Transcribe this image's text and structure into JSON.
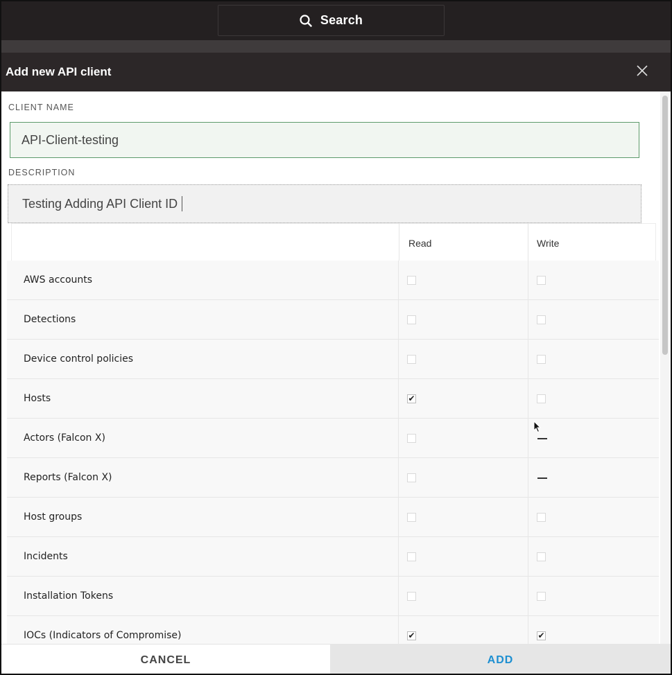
{
  "topbar": {
    "search_label": "Search"
  },
  "modal": {
    "title": "Add new API client"
  },
  "form": {
    "client_name_label": "CLIENT NAME",
    "client_name_value": "API-Client-testing",
    "description_label": "DESCRIPTION",
    "description_value": "Testing Adding API Client ID"
  },
  "permissions": {
    "read_header": "Read",
    "write_header": "Write",
    "rows": [
      {
        "name": "AWS accounts",
        "read": "unchecked",
        "write": "unchecked"
      },
      {
        "name": "Detections",
        "read": "unchecked",
        "write": "unchecked"
      },
      {
        "name": "Device control policies",
        "read": "unchecked",
        "write": "unchecked"
      },
      {
        "name": "Hosts",
        "read": "checked",
        "write": "unchecked"
      },
      {
        "name": "Actors (Falcon X)",
        "read": "unchecked",
        "write": "unavailable"
      },
      {
        "name": "Reports (Falcon X)",
        "read": "unchecked",
        "write": "unavailable"
      },
      {
        "name": "Host groups",
        "read": "unchecked",
        "write": "unchecked"
      },
      {
        "name": "Incidents",
        "read": "unchecked",
        "write": "unchecked"
      },
      {
        "name": "Installation Tokens",
        "read": "unchecked",
        "write": "unchecked"
      },
      {
        "name": "IOCs (Indicators of Compromise)",
        "read": "checked",
        "write": "checked"
      }
    ]
  },
  "footer": {
    "cancel_label": "CANCEL",
    "add_label": "ADD"
  },
  "colors": {
    "accent": "#1d8fd1",
    "header_bg": "#2c2728",
    "topbar_bg": "#242021",
    "valid_border": "#5c9a6a"
  }
}
